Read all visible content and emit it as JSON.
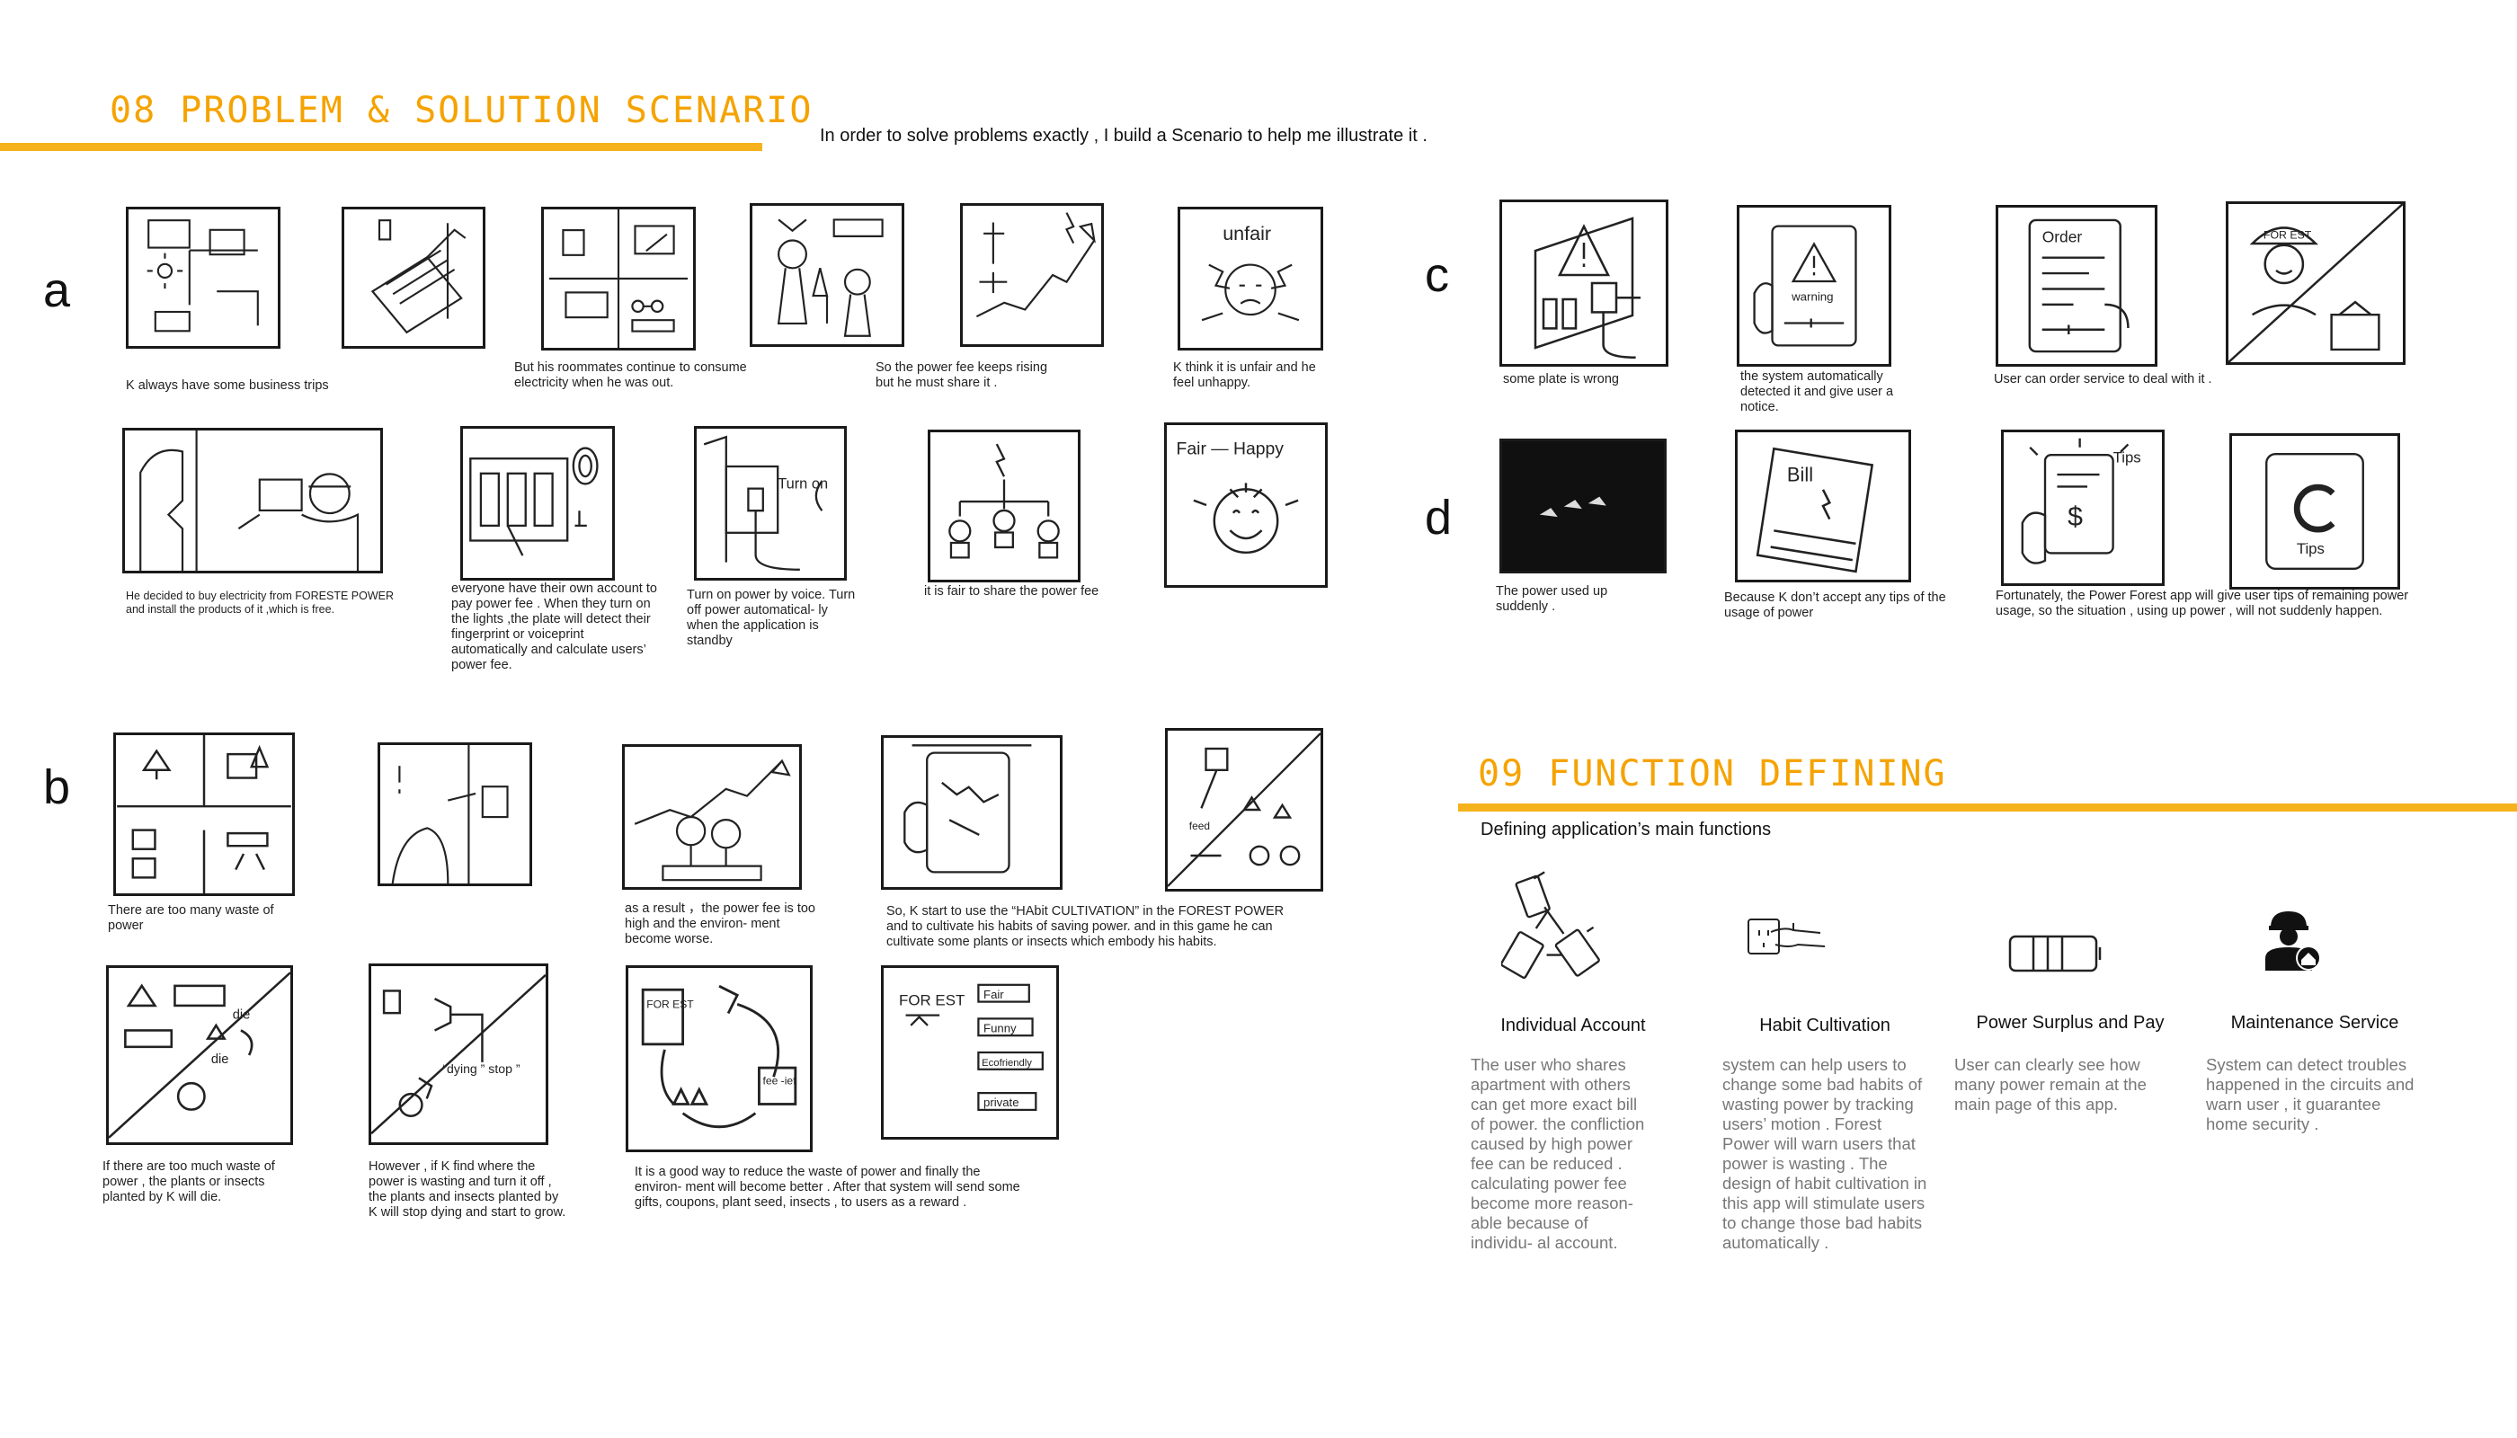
{
  "section08": {
    "title": "08 PROBLEM & SOLUTION SCENARIO",
    "intro": "In order to solve problems exactly , I build a Scenario to help me illustrate it ."
  },
  "rows": {
    "a": "a",
    "b": "b",
    "c": "c",
    "d": "d"
  },
  "panels": {
    "a_top": {
      "items": [
        {
          "caption": "K always have some business trips",
          "icon": "room-floorplan-sketch"
        },
        {
          "caption": "",
          "icon": "luggage-door-sketch"
        },
        {
          "caption": "But his roommates continue to consume electricity when he was out.",
          "icon": "appliances-sketch"
        },
        {
          "caption": "",
          "icon": "roommates-party-sketch"
        },
        {
          "caption": "So the power fee keeps rising but he must share it .",
          "icon": "rising-arrow-sketch"
        },
        {
          "caption": "K think it is unfair and he feel unhappy.",
          "icon": "unfair-angry-sketch"
        }
      ]
    },
    "a_bottom": {
      "items": [
        {
          "caption": "He decided to buy electricity from FORESTE POWER and install the products of it ,which is free.",
          "icon": "installer-sketch"
        },
        {
          "caption": "everyone have their own account to pay power fee . When they turn on the lights ,the plate will detect their fingerprint or voiceprint automatically and calculate users’ power fee.",
          "icon": "fingerprint-plate-sketch"
        },
        {
          "caption": "Turn on power by voice. Turn off power automatical- ly when the application is standby",
          "icon": "voice-plug-sketch",
          "label": "Turn on"
        },
        {
          "caption": "it is fair to share the power fee",
          "icon": "share-tree-sketch"
        },
        {
          "caption": "",
          "icon": "fair-happy-sketch",
          "label": "Fair — Happy"
        }
      ]
    },
    "b_top": {
      "items": [
        {
          "caption": "There are too many waste of power",
          "icon": "waste-rooms-sketch"
        },
        {
          "caption": "",
          "icon": "switch-thinking-sketch"
        },
        {
          "caption": "as a result ，the power fee is too high and the environ- ment become worse.",
          "icon": "trees-rising-sketch"
        },
        {
          "caption": "So, K start to use the “HAbit CULTIVATION” in the FOREST POWER and to cultivate his habits of saving power. and in this game he can cultivate some plants or insects which embody his habits.",
          "icon": "phone-game-sketch"
        },
        {
          "caption": "",
          "icon": "plants-grow-sketch",
          "label": "feed"
        }
      ]
    },
    "b_bottom": {
      "items": [
        {
          "caption": "If there are too much waste of power , the plants or insects planted by K will die.",
          "icon": "plants-die-sketch",
          "labels": [
            "die",
            "die"
          ]
        },
        {
          "caption": "However , if K find where the power is wasting and turn it off , the plants and insects planted by K will stop dying and start to grow.",
          "icon": "stop-dying-sketch",
          "label": "“dying ” stop ”"
        },
        {
          "caption": "It is a good way to reduce the waste of power and finally the environ- ment will become better . After that system will send some gifts, coupons, plant seed, insects , to users as a reward .",
          "icon": "reward-cycle-sketch",
          "labels": [
            "FOR EST",
            "fee -ief"
          ]
        },
        {
          "caption": "",
          "icon": "tags-list-sketch",
          "labels": [
            "FOR EST",
            "Fair",
            "Funny",
            "Ecofriendly",
            "private"
          ]
        }
      ]
    },
    "c": {
      "items": [
        {
          "caption": "some plate is wrong",
          "icon": "warning-plate-sketch"
        },
        {
          "caption": "the system automatically detected it and give user a notice.",
          "icon": "warning-phone-sketch",
          "label": "warning"
        },
        {
          "caption": "User can order service to deal with it .",
          "icon": "order-phone-sketch",
          "label": "Order"
        },
        {
          "caption": "",
          "icon": "service-worker-sketch",
          "label": "FOR EST"
        }
      ]
    },
    "d": {
      "items": [
        {
          "caption": "The power used up suddenly .",
          "icon": "dark-room-sketch"
        },
        {
          "caption": "Because K don’t accept any tips of the usage of power",
          "icon": "bill-sketch",
          "label": "Bill"
        },
        {
          "caption": "Fortunately, the Power Forest app will give user tips of remaining power usage, so the situation , using up power , will not suddenly happen.",
          "icon": "tips-phone-sketch",
          "label": "Tips"
        },
        {
          "caption": "",
          "icon": "tips-app-sketch",
          "label": "Tips"
        }
      ]
    }
  },
  "section09": {
    "title": "09 FUNCTION DEFINING",
    "subtitle": "Defining application’s main functions",
    "functions": [
      {
        "title": "Individual Account",
        "icon": "phones-link-icon",
        "desc": "The user who shares apartment with others can get more exact bill of power. the confliction caused by high power fee can be reduced . calculating power fee become more reason- able because of individu- al account."
      },
      {
        "title": "Habit Cultivation",
        "icon": "hand-socket-icon",
        "desc": "system can help users to change some bad habits of wasting power by tracking users’ motion . Forest Power will warn users that power is wasting . The design of habit cultivation in this app will stimulate users to change those bad habits automatically ."
      },
      {
        "title": "Power Surplus and Pay",
        "icon": "battery-icon",
        "desc": "User can clearly see how many power remain at the main page of this app."
      },
      {
        "title": "Maintenance Service",
        "icon": "worker-home-icon",
        "desc": "System can detect troubles happened in the circuits and warn user , it guarantee home security ."
      }
    ]
  }
}
